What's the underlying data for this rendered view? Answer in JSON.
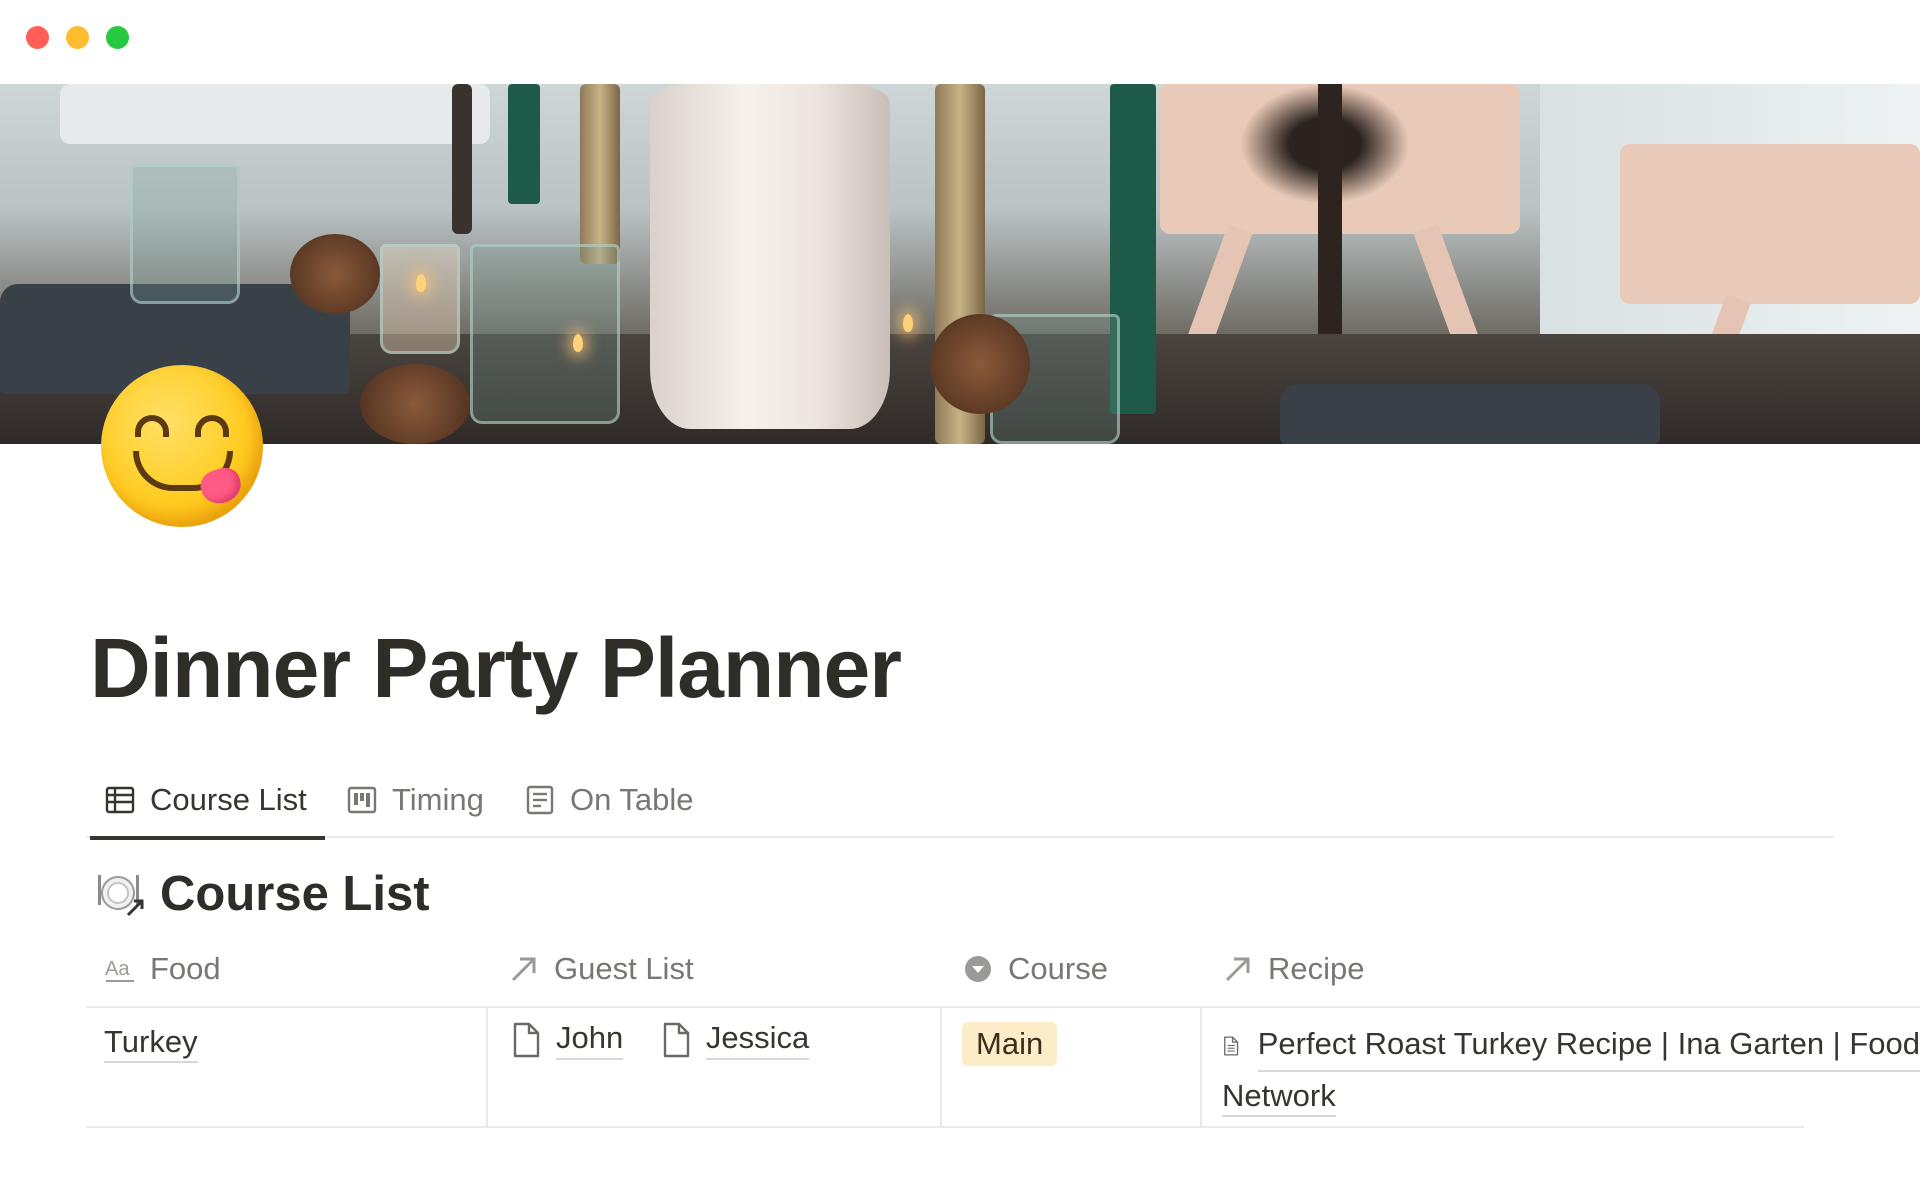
{
  "window": {
    "controls": [
      "close",
      "minimize",
      "zoom"
    ]
  },
  "page": {
    "icon": "face-savoring-food-emoji",
    "title": "Dinner Party Planner"
  },
  "tabs": [
    {
      "label": "Course List",
      "icon": "table-icon",
      "active": true
    },
    {
      "label": "Timing",
      "icon": "board-icon",
      "active": false
    },
    {
      "label": "On Table",
      "icon": "list-icon",
      "active": false
    }
  ],
  "database": {
    "icon": "plate-link-icon",
    "title": "Course List",
    "columns": [
      {
        "label": "Food",
        "icon": "title-aa-icon"
      },
      {
        "label": "Guest List",
        "icon": "relation-arrow-icon"
      },
      {
        "label": "Course",
        "icon": "select-icon"
      },
      {
        "label": "Recipe",
        "icon": "relation-arrow-icon"
      }
    ],
    "rows": [
      {
        "food": "Turkey",
        "guests": [
          "John",
          "Jessica"
        ],
        "course": "Main",
        "recipe_line1": "Perfect Roast Turkey Recipe | Ina Garten | Food",
        "recipe_line2": "Network"
      }
    ]
  },
  "colors": {
    "text": "#37352f",
    "muted": "#787774",
    "tag_bg": "#fdecc8",
    "divider": "#e9e9e7"
  }
}
